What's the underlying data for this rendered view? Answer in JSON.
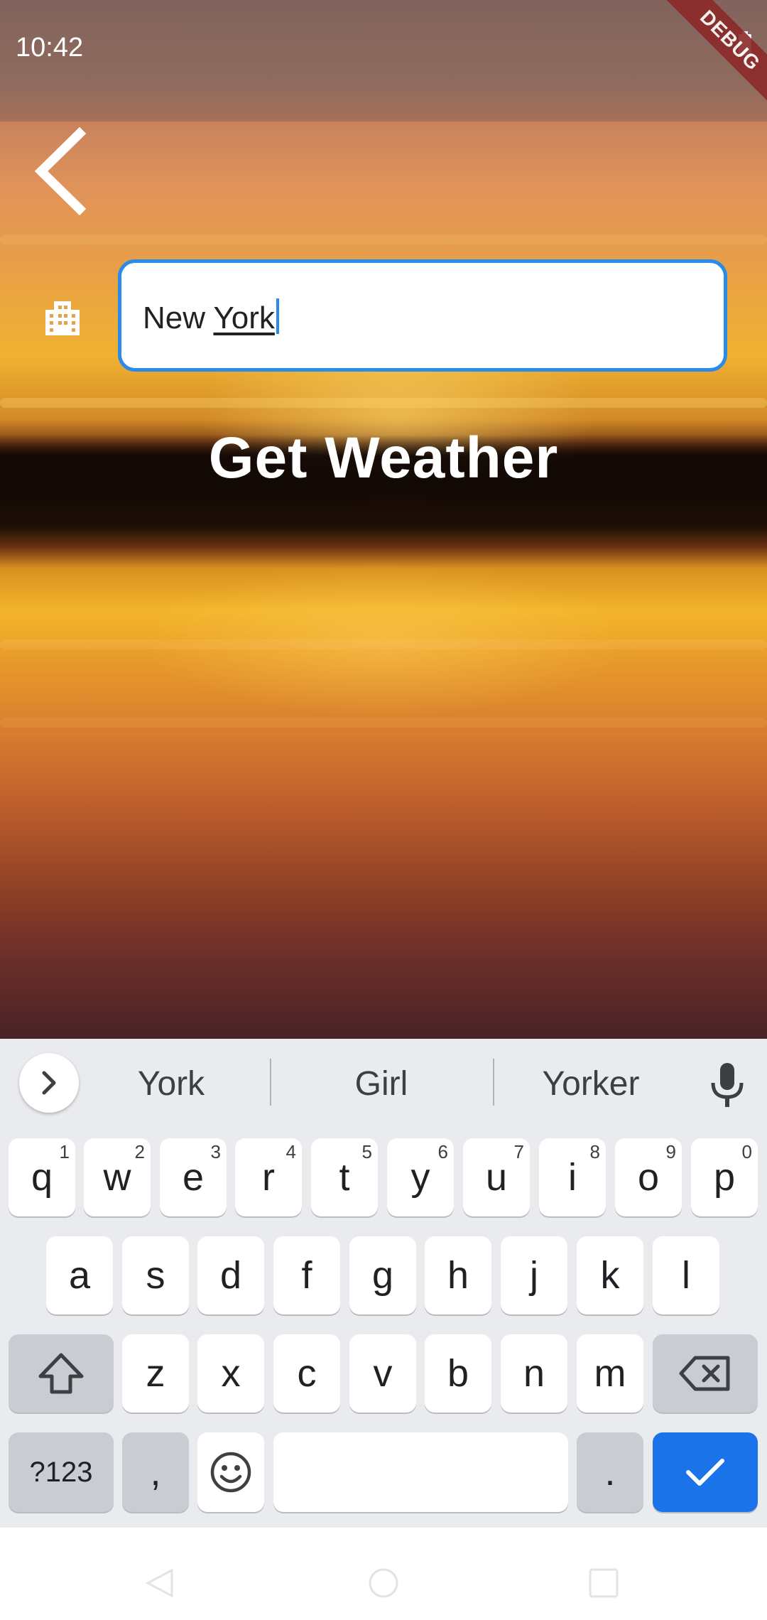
{
  "status_bar": {
    "time": "10:42",
    "debug_label": "DEBUG"
  },
  "search": {
    "city_value_plain": "New ",
    "city_value_composing": "York"
  },
  "action": {
    "get_weather_label": "Get Weather"
  },
  "keyboard": {
    "suggestions": [
      "York",
      "Girl",
      "Yorker"
    ],
    "row1": [
      {
        "key": "q",
        "hint": "1"
      },
      {
        "key": "w",
        "hint": "2"
      },
      {
        "key": "e",
        "hint": "3"
      },
      {
        "key": "r",
        "hint": "4"
      },
      {
        "key": "t",
        "hint": "5"
      },
      {
        "key": "y",
        "hint": "6"
      },
      {
        "key": "u",
        "hint": "7"
      },
      {
        "key": "i",
        "hint": "8"
      },
      {
        "key": "o",
        "hint": "9"
      },
      {
        "key": "p",
        "hint": "0"
      }
    ],
    "row2": [
      "a",
      "s",
      "d",
      "f",
      "g",
      "h",
      "j",
      "k",
      "l"
    ],
    "row3": [
      "z",
      "x",
      "c",
      "v",
      "b",
      "n",
      "m"
    ],
    "symbols_key": "?123",
    "comma_key": ",",
    "period_key": "."
  },
  "colors": {
    "accent": "#2a8be8",
    "enter_key": "#1a73e8",
    "keyboard_bg": "#e9ebef"
  },
  "icons": [
    "back-arrow-icon",
    "city-icon",
    "chevron-right-icon",
    "mic-icon",
    "shift-icon",
    "backspace-icon",
    "emoji-icon",
    "check-icon",
    "nav-back-icon",
    "nav-home-icon",
    "nav-recents-icon"
  ]
}
